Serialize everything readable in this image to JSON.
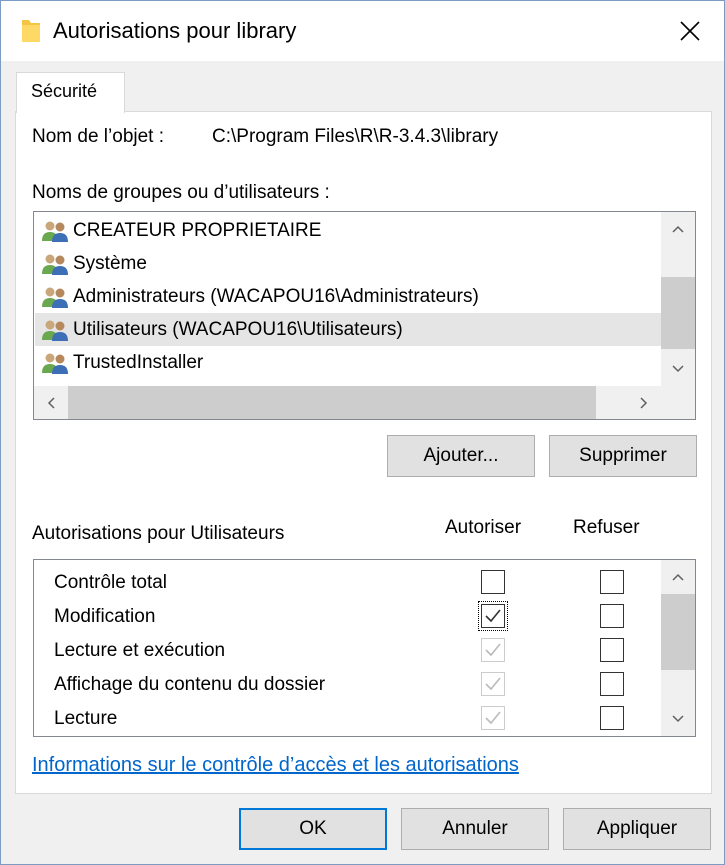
{
  "window": {
    "title": "Autorisations pour library"
  },
  "tabs": [
    {
      "label": "Sécurité",
      "active": true
    }
  ],
  "object": {
    "name_label": "Nom de l’objet :",
    "name_value": "C:\\Program Files\\R\\R-3.4.3\\library"
  },
  "groups": {
    "label": "Noms de groupes ou d’utilisateurs :",
    "items": [
      {
        "label": "CREATEUR PROPRIETAIRE",
        "icon": "users-group-icon",
        "selected": false
      },
      {
        "label": "Système",
        "icon": "users-group-icon",
        "selected": false
      },
      {
        "label": "Administrateurs (WACAPOU16\\Administrateurs)",
        "icon": "users-group-icon",
        "selected": false
      },
      {
        "label": "Utilisateurs (WACAPOU16\\Utilisateurs)",
        "icon": "users-group-icon",
        "selected": true
      },
      {
        "label": "TrustedInstaller",
        "icon": "users-group-icon",
        "selected": false
      }
    ],
    "add_button": "Ajouter...",
    "remove_button": "Supprimer"
  },
  "permissions": {
    "label": "Autorisations pour Utilisateurs",
    "allow_header": "Autoriser",
    "deny_header": "Refuser",
    "rows": [
      {
        "name": "Contrôle total",
        "allow": false,
        "allow_disabled": false,
        "deny": false
      },
      {
        "name": "Modification",
        "allow": true,
        "allow_disabled": false,
        "deny": false
      },
      {
        "name": "Lecture et exécution",
        "allow": true,
        "allow_disabled": true,
        "deny": false
      },
      {
        "name": "Affichage du contenu du dossier",
        "allow": true,
        "allow_disabled": true,
        "deny": false
      },
      {
        "name": "Lecture",
        "allow": true,
        "allow_disabled": true,
        "deny": false
      }
    ]
  },
  "link": {
    "text": "Informations sur le contrôle d’accès et les autorisations"
  },
  "footer": {
    "ok": "OK",
    "cancel": "Annuler",
    "apply": "Appliquer"
  },
  "colors": {
    "accent": "#0078d7",
    "link": "#0066cc",
    "selection": "#e5e5e5"
  }
}
